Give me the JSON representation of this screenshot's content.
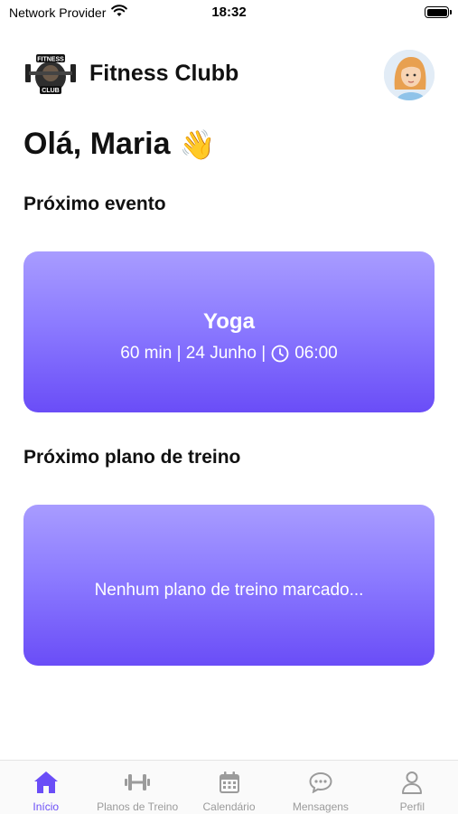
{
  "status_bar": {
    "carrier": "Network Provider",
    "time": "18:32",
    "wifi_icon": "wifi-icon",
    "battery_icon": "battery-icon"
  },
  "header": {
    "logo_text_top": "FITNESS",
    "logo_text_bottom": "CLUB",
    "title": "Fitness Clubb",
    "avatar_icon": "user-avatar"
  },
  "greeting": {
    "text": "Olá, Maria",
    "emoji": "👋"
  },
  "next_event": {
    "section_title": "Próximo evento",
    "name": "Yoga",
    "meta_prefix": "60 min | 24 Junho |",
    "time": "06:00",
    "icon": "clock-icon"
  },
  "next_plan": {
    "section_title": "Próximo plano de treino",
    "empty_text": "Nenhum plano de treino marcado..."
  },
  "colors": {
    "accent": "#6a4df7",
    "card_top": "#a89cff",
    "card_bottom": "#6a4df7",
    "tab_inactive": "#9b9b9b"
  },
  "tabbar": {
    "tabs": [
      {
        "label": "Início",
        "icon": "home-icon",
        "active": true
      },
      {
        "label": "Planos de Treino",
        "icon": "dumbbell-icon",
        "active": false
      },
      {
        "label": "Calendário",
        "icon": "calendar-icon",
        "active": false
      },
      {
        "label": "Mensagens",
        "icon": "chat-icon",
        "active": false
      },
      {
        "label": "Perfil",
        "icon": "profile-icon",
        "active": false
      }
    ]
  }
}
